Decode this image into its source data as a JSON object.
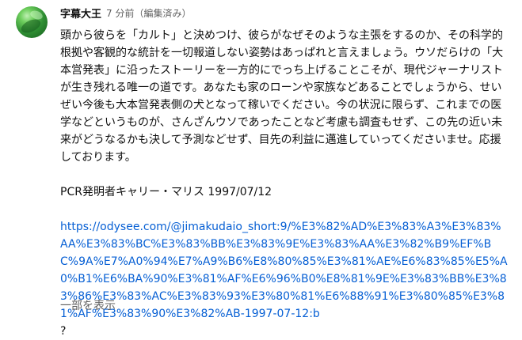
{
  "comment": {
    "author": "字幕大王",
    "time": "7 分前",
    "edited": "（編集済み）",
    "text": "頭から彼らを「カルト」と決めつけ、彼らがなぜそのような主張をするのか、その科学的根拠や客観的な統計を一切報道しない姿勢はあっぱれと言えましょう。ウソだらけの「大本営発表」に沿ったストーリーを一方的にでっち上げることこそが、現代ジャーナリストが生き残れる唯一の道です。あなたも家のローンや家族などあることでしょうから、せいぜい今後も大本営発表側の犬となって稼いでください。今の状況に限らず、これまでの医学などというものが、さんざんウソであったことなど考慮も調査もせず、この先の近い未来がどうなるかも決して予測などせず、目先の利益に邁進していってくださいませ。応援しております。",
    "quote": "PCR発明者キャリー・マリス 1997/07/12",
    "link": "https://odysee.com/@jimakudaio_short:9/%E3%82%AD%E3%83%A3%E3%83%AA%E3%83%BC%E3%83%BB%E3%83%9E%E3%83%AA%E3%82%B9%EF%BC%9A%E7%A0%94%E7%A9%B6%E8%80%85%E3%81%AE%E6%83%85%E5%A0%B1%E6%BA%90%E3%81%AF%E6%96%B0%E8%81%9E%E3%83%BB%E3%83%86%E3%83%AC%E3%83%93%E3%80%81%E6%88%91%E3%80%85%E3%81%AF%E3%83%90%E3%82%AB-1997-07-12:b",
    "trailing": "?",
    "show_more": "一部を表示"
  },
  "colors": {
    "text": "#0f0f0f",
    "secondary": "#606060",
    "link": "#065fd4",
    "background": "#ffffff"
  }
}
